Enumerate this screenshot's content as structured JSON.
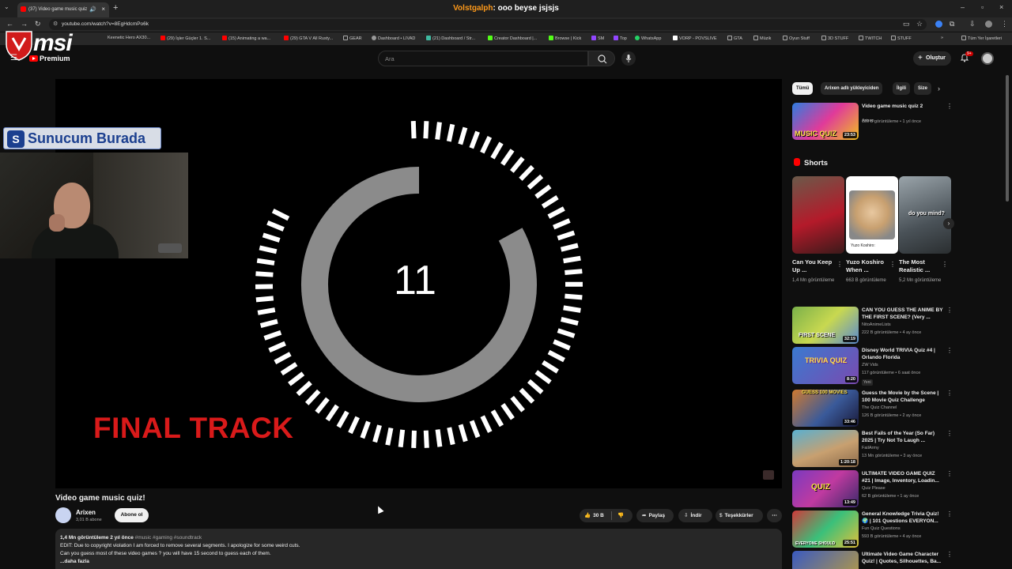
{
  "browser": {
    "tab_title": "(37) Video game music quiz",
    "url": "youtube.com/watch?v=8EgHdcmPo6k",
    "chat_user": "Volstgalph",
    "chat_message": ": ooo beyse jsjsjs",
    "bookmarks": [
      "Keenetic Hero AX30...",
      "(29) İşler Güçler 1. S...",
      "(15) Animating a wa...",
      "(29) GTA V All Rusty...",
      "GEAR",
      "Dashboard • LIVAD",
      "(21) Dashboard / Str...",
      "Creator Dashboard |...",
      "Browse | Kick",
      "SM",
      "Top",
      "WhatsApp",
      "VORP - POVSLIVE",
      "GTA",
      "Müzik",
      "Oyun Stuff",
      "3D STUFF",
      "TWITCH",
      "STUFF",
      "Tüm Yer İşaretleri"
    ]
  },
  "header": {
    "brand_text": "msi",
    "premium_label": "Premium",
    "search_placeholder": "Ara",
    "create_label": "Oluştur",
    "notif_count": "9+"
  },
  "player": {
    "countdown": "11",
    "overlay_text": "FINAL TRACK",
    "ring_fraction": 0.83,
    "sponsor_logo": "S",
    "sponsor_text": "Sunucum Burada"
  },
  "video": {
    "title": "Video game music quiz!",
    "channel": "Arixen",
    "subscribers": "3,01 B abone",
    "subscribe_label": "Abone ol",
    "likes": "30 B",
    "share_label": "Paylaş",
    "download_label": "İndir",
    "thanks_label": "Teşekkürler",
    "desc_meta": "1,4 Mn görüntüleme  2 yıl önce",
    "desc_tags": "#music #gaming #soundtrack",
    "desc_line1": "EDIT: Due to copyright violation I am forced to remove several segments. I apologize for some weird cuts.",
    "desc_line2": "Can you guess most of these video games ? you will have 15 second to guess each of them.",
    "desc_more": "...daha fazla"
  },
  "sidebar": {
    "chips": [
      "Tümü",
      "Arixen adlı yükleyiciden",
      "İlgili",
      "Size"
    ],
    "first": {
      "title": "Video game music quiz 2",
      "channel": "Arixen",
      "stats": "189 B görüntüleme • 1 yıl önce",
      "duration": "23:53"
    },
    "shorts_header": "Shorts",
    "shorts": [
      {
        "title": "Can You Keep Up ...",
        "views": "1,4 Mn görüntüleme"
      },
      {
        "title": "Yuzo Koshiro When ...",
        "views": "663 B görüntüleme"
      },
      {
        "title": "The Most Realistic ...",
        "views": "5,2 Mn görüntüleme"
      }
    ],
    "short2_caption": "Yuzo Koshiro:",
    "short3_caption": "do you mind?",
    "videos": [
      {
        "title": "CAN YOU GUESS THE ANIME BY THE FIRST SCENE? (Very ...",
        "channel": "NitoAnimeLists",
        "stats": "222 B görüntüleme • 4 ay önce",
        "duration": "32:19",
        "badge": ""
      },
      {
        "title": "Disney World TRIVIA Quiz #4 | Orlando Florida",
        "channel": "ZW Vids",
        "stats": "117 görüntüleme • 6 saat önce",
        "duration": "8:20",
        "badge": "Yeni"
      },
      {
        "title": "Guess the Movie by the Scene | 100 Movie Quiz Challenge",
        "channel": "The Quiz Channel",
        "stats": "126 B görüntüleme • 2 ay önce",
        "duration": "33:46",
        "badge": ""
      },
      {
        "title": "Best Fails of the Year (So Far) 2025 | Try Not To Laugh ...",
        "channel": "FailArmy",
        "stats": "13 Mn görüntüleme • 3 ay önce",
        "duration": "1:20:18",
        "badge": ""
      },
      {
        "title": "ULTIMATE VIDEO GAME QUIZ #21 | Image, Inventory, Loadin...",
        "channel": "Quiz Please",
        "stats": "62 B görüntüleme • 1 ay önce",
        "duration": "13:49",
        "badge": ""
      },
      {
        "title": "General Knowledge Trivia Quiz! 🌍 | 101 Questions EVERYON...",
        "channel": "Fun Quiz Questions",
        "stats": "593 B görüntüleme • 4 ay önce",
        "duration": "25:51",
        "badge": ""
      },
      {
        "title": "Ultimate Video Game Character Quiz! | Quotes, Silhouettes, Ba...",
        "channel": "",
        "stats": "",
        "duration": "",
        "badge": ""
      }
    ],
    "thumb_texts": [
      "MUSIC QUIZ",
      "FIRST SCENE",
      "TRIVIA QUIZ",
      "GUESS 100 MOVIES",
      "",
      "QUIZ",
      "EVERYONE SHOULD",
      ""
    ]
  }
}
